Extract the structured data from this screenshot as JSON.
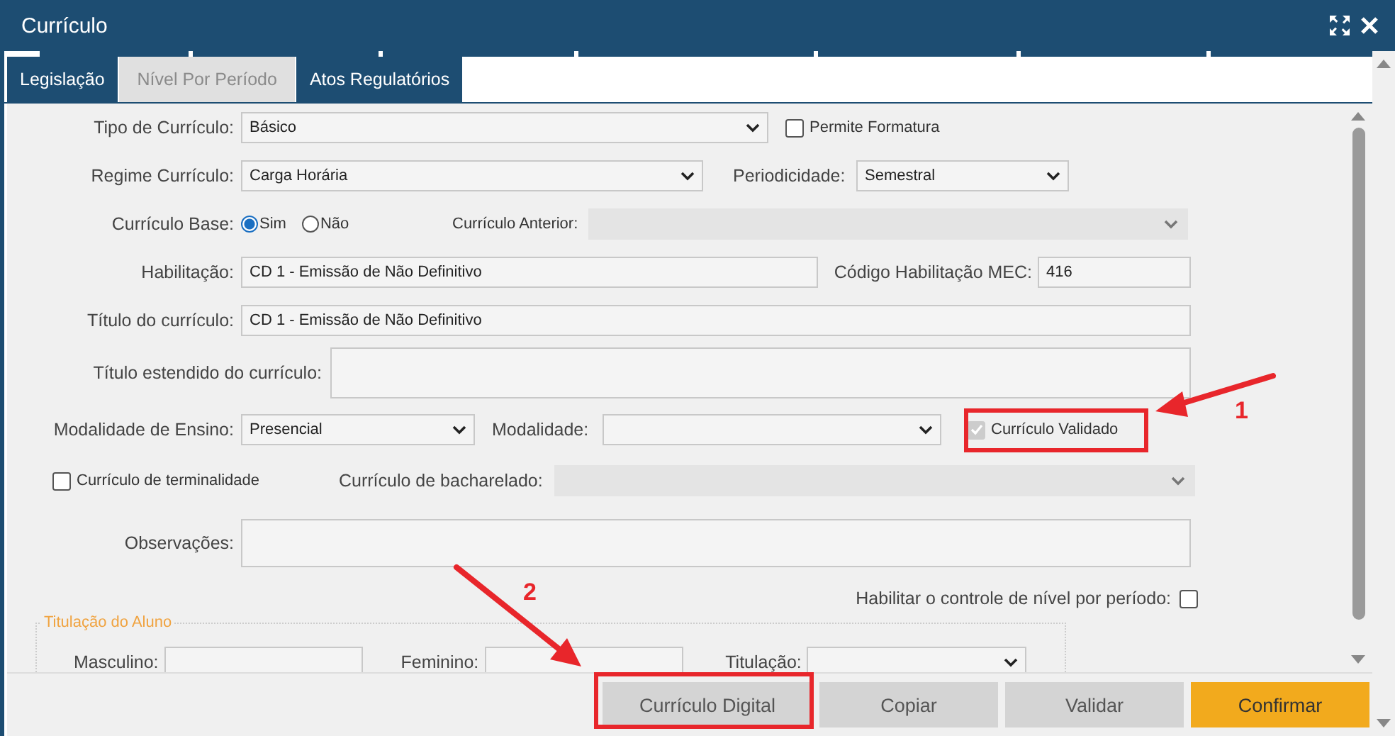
{
  "window": {
    "title": "Currículo"
  },
  "tabs": [
    {
      "label": "Legislação",
      "disabled": false
    },
    {
      "label": "Nível Por Período",
      "disabled": true
    },
    {
      "label": "Atos Regulatórios",
      "disabled": false
    }
  ],
  "form": {
    "tipo_curriculo": {
      "label": "Tipo de Currículo:",
      "value": "Básico",
      "disabled": false
    },
    "permite_formatura": {
      "label": "Permite Formatura",
      "checked": false,
      "disabled": false
    },
    "regime_curriculo": {
      "label": "Regime Currículo:",
      "value": "Carga Horária",
      "disabled": false
    },
    "periodicidade": {
      "label": "Periodicidade:",
      "value": "Semestral",
      "disabled": false
    },
    "curriculo_base": {
      "label": "Currículo Base:",
      "options": [
        {
          "label": "Sim",
          "selected": true
        },
        {
          "label": "Não",
          "selected": false
        }
      ]
    },
    "curriculo_anterior": {
      "label": "Currículo Anterior:",
      "disabled": true
    },
    "habilitacao": {
      "label": "Habilitação:",
      "value": "CD 1 - Emissão de Não Definitivo"
    },
    "codigo_habilitacao_mec": {
      "label": "Código Habilitação MEC:",
      "value": "416"
    },
    "titulo_curriculo": {
      "label": "Título do currículo:",
      "value": "CD 1 - Emissão de Não Definitivo"
    },
    "titulo_estendido": {
      "label": "Título estendido do currículo:"
    },
    "modalidade_ensino": {
      "label": "Modalidade de Ensino:",
      "value": "Presencial",
      "disabled": false
    },
    "modalidade": {
      "label": "Modalidade:",
      "disabled": false
    },
    "curriculo_validado": {
      "label": "Currículo Validado",
      "checked": true,
      "disabled": true
    },
    "curriculo_terminalidade": {
      "label": "Currículo de terminalidade",
      "checked": false,
      "disabled": false
    },
    "curriculo_bacharelado": {
      "label": "Currículo de bacharelado:",
      "disabled": true
    },
    "observacoes": {
      "label": "Observações:"
    },
    "habilitar_controle": {
      "label": "Habilitar o controle de nível por período:",
      "checked": false,
      "disabled": false
    },
    "titulacao_aluno": {
      "legend": "Titulação do Aluno",
      "masculino": "Masculino:",
      "feminino": "Feminino:",
      "titulacao": "Titulação:"
    }
  },
  "buttons": [
    {
      "label": "Currículo Digital",
      "kind": "default"
    },
    {
      "label": "Copiar",
      "kind": "default"
    },
    {
      "label": "Validar",
      "kind": "default"
    },
    {
      "label": "Confirmar",
      "kind": "primary"
    }
  ],
  "annotations": [
    {
      "number": "1"
    },
    {
      "number": "2"
    }
  ]
}
